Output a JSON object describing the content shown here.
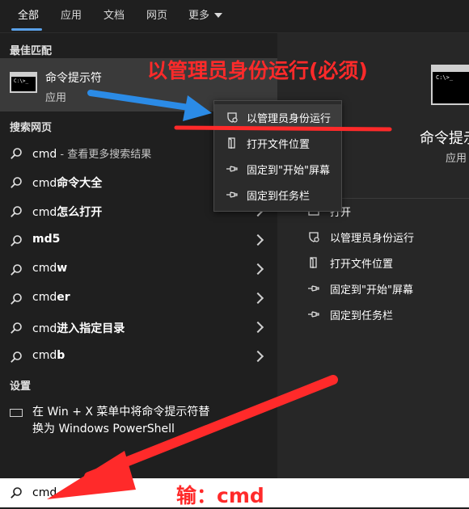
{
  "tabs": [
    {
      "label": "全部",
      "active": true
    },
    {
      "label": "应用"
    },
    {
      "label": "文档"
    },
    {
      "label": "网页"
    },
    {
      "label": "更多"
    }
  ],
  "sections": {
    "best_match": "最佳匹配",
    "web_search": "搜索网页",
    "settings": "设置"
  },
  "best_match": {
    "title": "命令提示符",
    "subtitle": "应用"
  },
  "web_results": [
    {
      "term": "cmd",
      "suffix": " - 查看更多搜索结果"
    },
    {
      "term": "cmd",
      "suffix": "命令大全"
    },
    {
      "term": "cmd",
      "suffix": "怎么打开"
    },
    {
      "term": "md5",
      "suffix": ""
    },
    {
      "term": "cmd",
      "suffix": "w"
    },
    {
      "term": "cmd",
      "suffix": "er"
    },
    {
      "term": "cmd",
      "suffix": "进入指定目录"
    },
    {
      "term": "cmd",
      "suffix": "b"
    }
  ],
  "settings_item": {
    "line1": "在 Win + X 菜单中将命令提示符替",
    "line2": "换为 Windows PowerShell"
  },
  "context_menu": [
    {
      "label": "以管理员身份运行",
      "icon": "shield-icon"
    },
    {
      "label": "打开文件位置",
      "icon": "folder-icon"
    },
    {
      "label": "固定到\"开始\"屏幕",
      "icon": "pin-icon"
    },
    {
      "label": "固定到任务栏",
      "icon": "pin-icon"
    }
  ],
  "right_panel": {
    "title": "命令提示",
    "subtitle": "应用",
    "actions": [
      {
        "label": "打开",
        "icon": "open-icon"
      },
      {
        "label": "以管理员身份运行",
        "icon": "shield-icon"
      },
      {
        "label": "打开文件位置",
        "icon": "folder-icon"
      },
      {
        "label": "固定到\"开始\"屏幕",
        "icon": "pin-icon"
      },
      {
        "label": "固定到任务栏",
        "icon": "pin-icon"
      }
    ]
  },
  "search": {
    "value": "cmd"
  },
  "annotations": {
    "top": "以管理员身份运行(必须)",
    "bottom": "输：cmd"
  },
  "colors": {
    "annotation_red": "#ff2a2a",
    "arrow_blue": "#2b8be6",
    "tab_accent": "#5aa0e8"
  }
}
